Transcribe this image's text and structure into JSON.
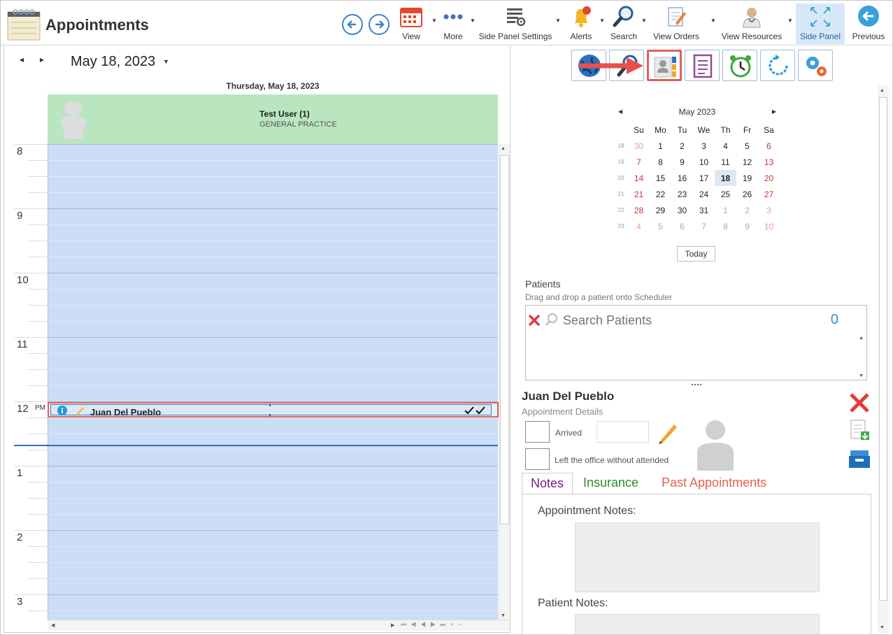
{
  "app": {
    "title": "Appointments"
  },
  "toolbar": {
    "items": [
      {
        "label": "View"
      },
      {
        "label": "More"
      },
      {
        "label": "Side Panel Settings"
      },
      {
        "label": "Alerts"
      },
      {
        "label": "Search"
      },
      {
        "label": "View Orders"
      },
      {
        "label": "View Resources"
      },
      {
        "label": "Side Panel"
      },
      {
        "label": "Previous"
      }
    ]
  },
  "scheduler": {
    "date": "May 18, 2023",
    "day_header": "Thursday, May 18, 2023",
    "resource": {
      "name": "Test User (1)",
      "specialty": "GENERAL PRACTICE"
    },
    "hours": [
      "8",
      "9",
      "10",
      "11",
      "12",
      "1",
      "2",
      "3"
    ],
    "pm_label": "PM",
    "appointment": {
      "patient": "Juan Del Pueblo"
    }
  },
  "calendar": {
    "month_title": "May 2023",
    "weekdays": [
      "Su",
      "Mo",
      "Tu",
      "We",
      "Th",
      "Fr",
      "Sa"
    ],
    "weeks": [
      {
        "wk": "18",
        "days": [
          "30",
          "1",
          "2",
          "3",
          "4",
          "5",
          "6"
        ]
      },
      {
        "wk": "19",
        "days": [
          "7",
          "8",
          "9",
          "10",
          "11",
          "12",
          "13"
        ]
      },
      {
        "wk": "20",
        "days": [
          "14",
          "15",
          "16",
          "17",
          "18",
          "19",
          "20"
        ]
      },
      {
        "wk": "21",
        "days": [
          "21",
          "22",
          "23",
          "24",
          "25",
          "26",
          "27"
        ]
      },
      {
        "wk": "22",
        "days": [
          "28",
          "29",
          "30",
          "31",
          "1",
          "2",
          "3"
        ]
      },
      {
        "wk": "23",
        "days": [
          "4",
          "5",
          "6",
          "7",
          "8",
          "9",
          "10"
        ]
      }
    ],
    "selected_day": "18",
    "today_label": "Today"
  },
  "patients": {
    "label": "Patients",
    "hint": "Drag and drop a patient onto Scheduler",
    "search_placeholder": "Search Patients",
    "count": "0"
  },
  "details": {
    "patient_name": "Juan Del Pueblo",
    "section_label": "Appointment Details",
    "arrived_label": "Arrived",
    "left_label": "Left the office without attended"
  },
  "tabs": [
    {
      "label": "Notes",
      "color": "#7a1c8c"
    },
    {
      "label": "Insurance",
      "color": "#2e8b2e"
    },
    {
      "label": "Past Appointments",
      "color": "#e8604c"
    }
  ],
  "notes": {
    "appointment_notes_label": "Appointment Notes:",
    "patient_notes_label": "Patient Notes:"
  },
  "colors": {
    "accent": "#3f82c9",
    "highlight": "#e0625a",
    "resource_bg": "#b9e5bf",
    "grid_bg": "#cbdef5"
  },
  "icons": [
    "app-calendar-icon",
    "back-arrow-icon",
    "forward-arrow-icon",
    "calendar-view-icon",
    "more-dots-icon",
    "side-panel-settings-icon",
    "alerts-bell-icon",
    "search-magnifier-icon",
    "view-orders-icon",
    "view-resources-icon",
    "side-panel-expand-icon",
    "previous-arrow-icon",
    "globe-icon",
    "patient-search-icon",
    "patient-details-icon",
    "clipboard-icon",
    "alarm-clock-icon",
    "refresh-icon",
    "settings-gears-icon",
    "info-icon",
    "delete-icon",
    "export-document-icon",
    "archive-tray-icon",
    "edit-pencil-icon",
    "avatar-placeholder-icon",
    "clear-search-icon"
  ]
}
